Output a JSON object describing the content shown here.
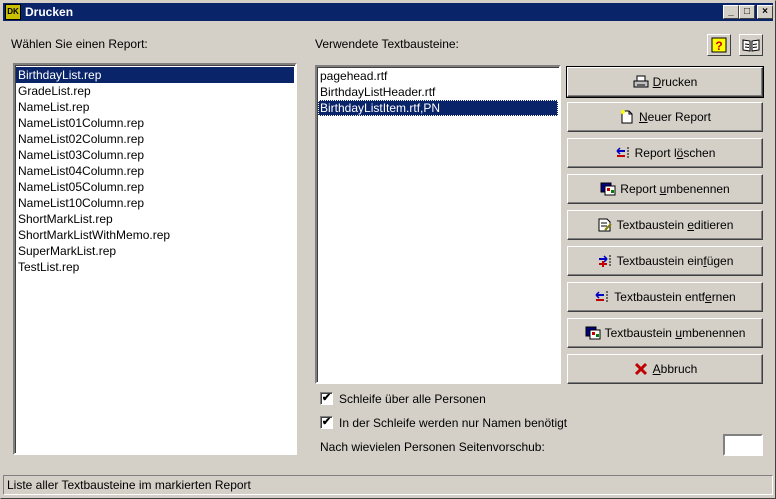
{
  "window": {
    "title": "Drucken",
    "app_icon_text": "DK",
    "minimize": "_",
    "maximize": "□",
    "close": "×"
  },
  "reports": {
    "label": "Wählen Sie einen Report:",
    "items": [
      "BirthdayList.rep",
      "GradeList.rep",
      "NameList.rep",
      "NameList01Column.rep",
      "NameList02Column.rep",
      "NameList03Column.rep",
      "NameList04Column.rep",
      "NameList05Column.rep",
      "NameList10Column.rep",
      "ShortMarkList.rep",
      "ShortMarkListWithMemo.rep",
      "SuperMarkList.rep",
      "TestList.rep"
    ],
    "selected_index": 0
  },
  "textblocks": {
    "label": "Verwendete Textbausteine:",
    "items": [
      "pagehead.rtf",
      "BirthdayListHeader.rtf",
      "BirthdayListItem.rtf,PN"
    ],
    "selected_index": 2
  },
  "buttons": {
    "print": {
      "pre": "",
      "key": "D",
      "post": "rucken"
    },
    "new_report": {
      "pre": "",
      "key": "N",
      "post": "euer Report"
    },
    "delete_report": {
      "pre": "Report l",
      "key": "ö",
      "post": "schen"
    },
    "rename_report": {
      "pre": "Report ",
      "key": "u",
      "post": "mbenennen"
    },
    "edit_block": {
      "pre": "Textbaustein ",
      "key": "e",
      "post": "ditieren"
    },
    "insert_block": {
      "pre": "Textbaustein ein",
      "key": "f",
      "post": "ügen"
    },
    "remove_block": {
      "pre": "Textbaustein entf",
      "key": "e",
      "post": "rnen"
    },
    "rename_block": {
      "pre": "Textbaustein ",
      "key": "u",
      "post": "mbenennen"
    },
    "cancel": {
      "pre": "",
      "key": "A",
      "post": "bbruch"
    }
  },
  "options": {
    "loop_all": {
      "label": "Schleife über alle Personen",
      "checked": true,
      "mark": "✔"
    },
    "names_only": {
      "label": "In der Schleife werden nur Namen benötigt",
      "checked": true,
      "mark": "✔"
    },
    "page_break_label": "Nach wievielen Personen Seitenvorschub:",
    "page_break_value": ""
  },
  "help": {
    "help_icon": "help-icon",
    "book_icon": "book-icon"
  },
  "status": {
    "text": "Liste aller Textbausteine im markierten Report"
  },
  "colors": {
    "titlebar": "#0a246a",
    "face": "#d4d0c8",
    "selection": "#0a246a",
    "cancel_icon": "#c00000"
  }
}
